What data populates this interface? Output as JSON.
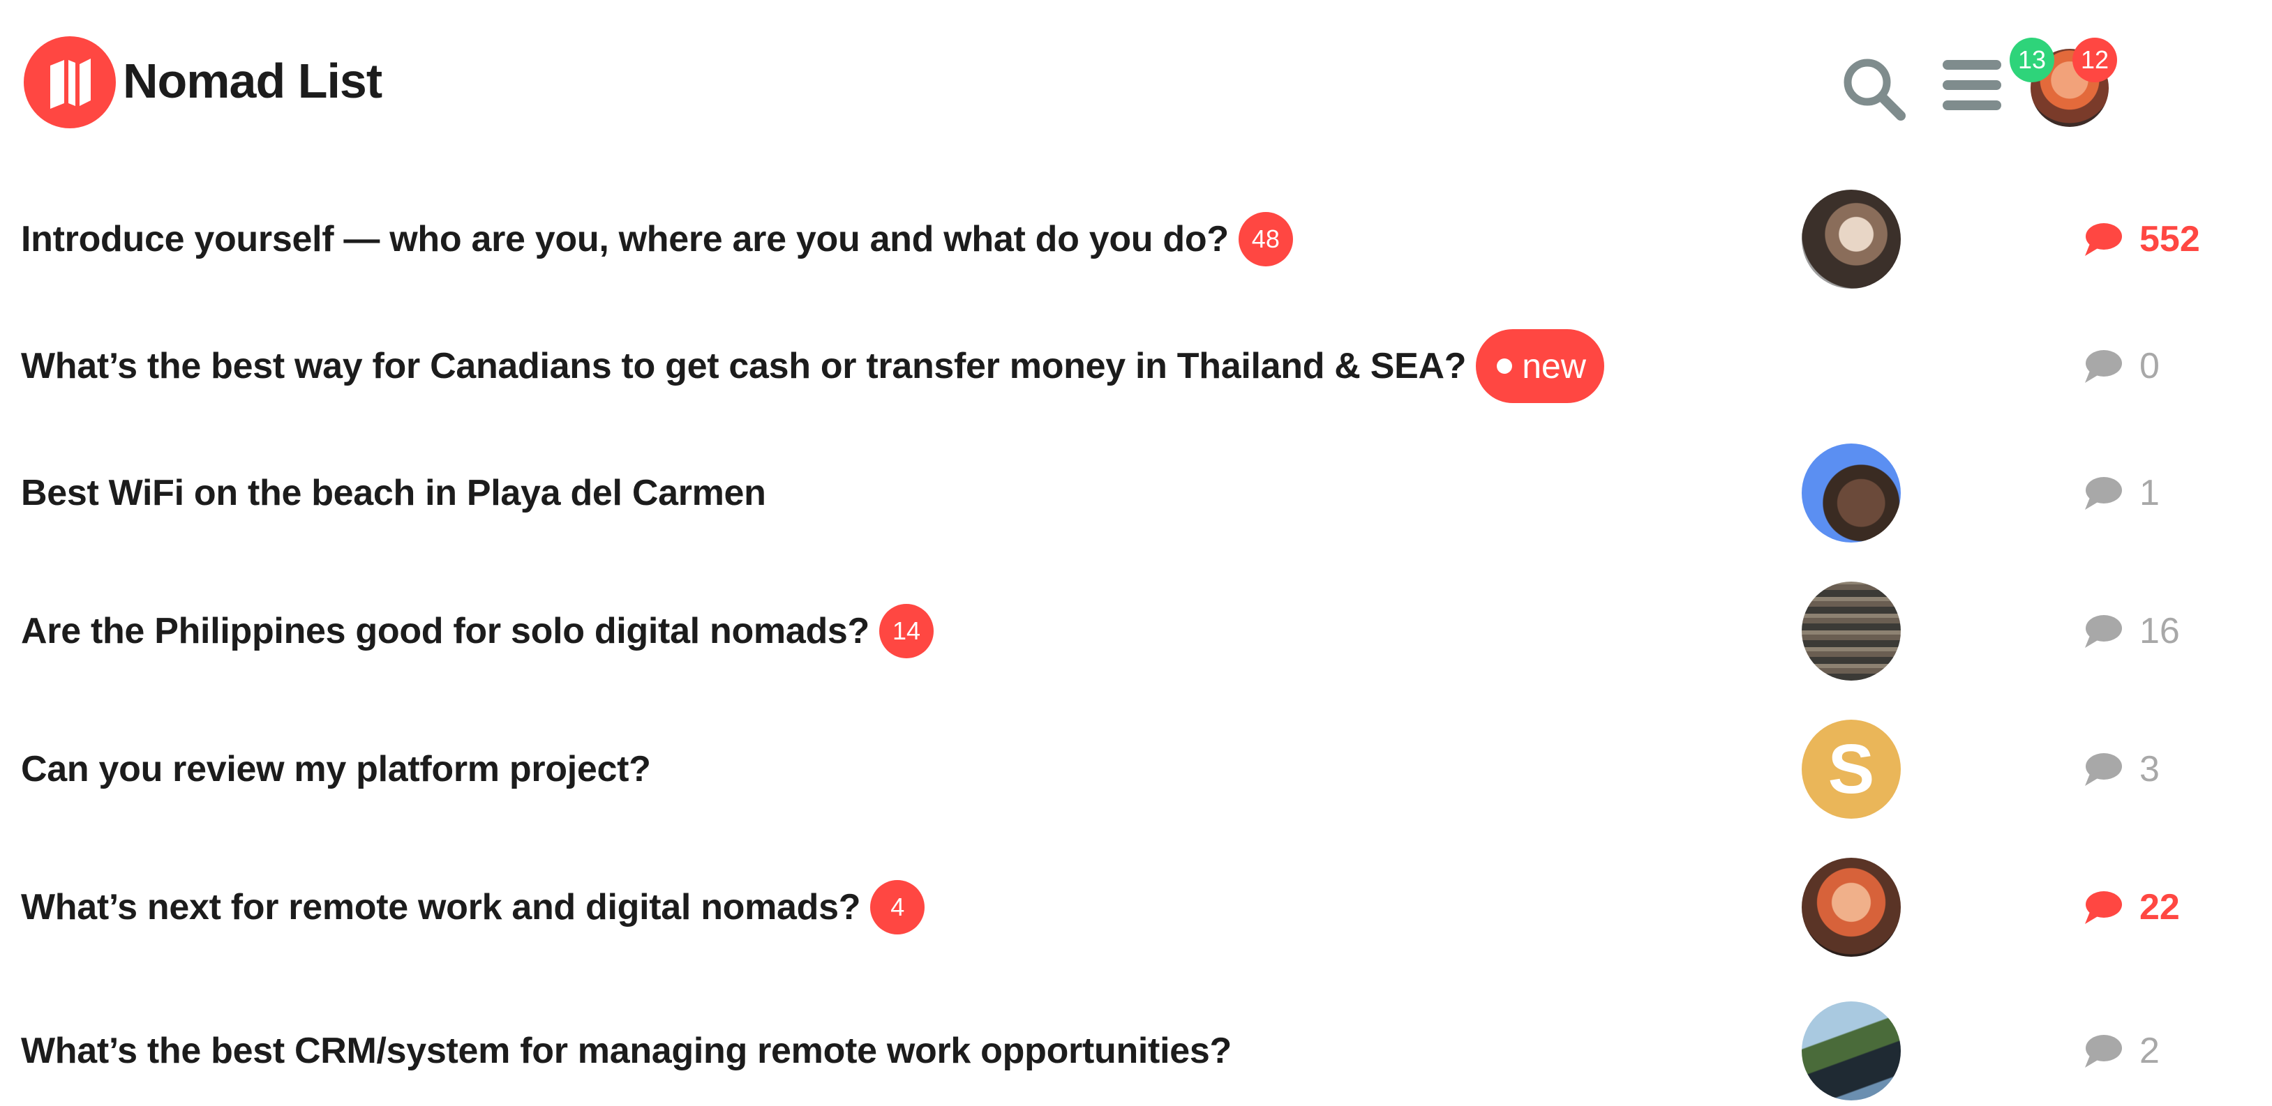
{
  "header": {
    "brand": "Nomad List",
    "notification_badge_green": "13",
    "notification_badge_red": "12"
  },
  "colors": {
    "accent": "#ff4742",
    "green": "#2ed47a",
    "muted": "#a8a8a8",
    "icon_gray": "#7f8c8d"
  },
  "threads": [
    {
      "title": "Introduce yourself — who are you, where are you and what do you do?",
      "badge": "48",
      "new_label": "",
      "comments": "552",
      "hot": true
    },
    {
      "title": "What’s the best way for Canadians to get cash or transfer money in Thailand & SEA?",
      "badge": "",
      "new_label": "new",
      "comments": "0",
      "hot": false
    },
    {
      "title": "Best WiFi on the beach in Playa del Carmen",
      "badge": "",
      "new_label": "",
      "comments": "1",
      "hot": false
    },
    {
      "title": "Are the Philippines good for solo digital nomads?",
      "badge": "14",
      "new_label": "",
      "comments": "16",
      "hot": false
    },
    {
      "title": "Can you review my platform project?",
      "badge": "",
      "new_label": "",
      "avatar_letter": "S",
      "comments": "3",
      "hot": false
    },
    {
      "title": "What’s next for remote work and digital nomads?",
      "badge": "4",
      "new_label": "",
      "comments": "22",
      "hot": true
    },
    {
      "title": "What’s the best CRM/system for managing remote work opportunities?",
      "badge": "",
      "new_label": "",
      "comments": "2",
      "hot": false
    }
  ]
}
